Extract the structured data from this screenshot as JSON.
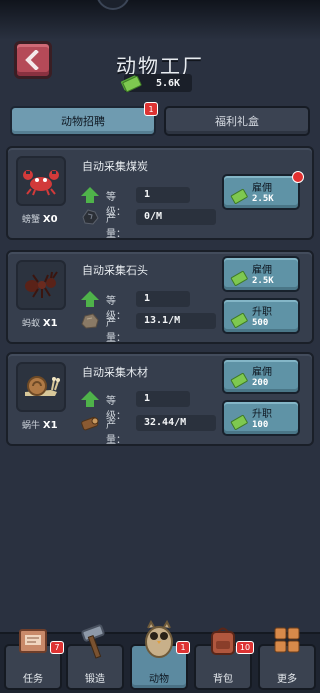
{
  "header": {
    "title": "动物工厂",
    "currency_value": "5.6K"
  },
  "tabs": [
    {
      "label": "动物招聘",
      "badge": "1",
      "active": true
    },
    {
      "label": "福利礼盒",
      "active": false
    }
  ],
  "animals": [
    {
      "name": "螃蟹",
      "count": "X0",
      "task": "自动采集煤炭",
      "level_label": "等级：",
      "level": "1",
      "output_label": "产量：",
      "output": "0/M",
      "resource_icon": "coal-icon",
      "hire_label": "雇佣",
      "hire_cost": "2.5K",
      "hire_notification": true
    },
    {
      "name": "蚂蚁",
      "count": "X1",
      "task": "自动采集石头",
      "level_label": "等级：",
      "level": "1",
      "output_label": "产量：",
      "output": "13.1/M",
      "resource_icon": "stone-icon",
      "hire_label": "雇佣",
      "hire_cost": "2.5K",
      "upgrade_label": "升职",
      "upgrade_cost": "500"
    },
    {
      "name": "蜗牛",
      "count": "X1",
      "task": "自动采集木材",
      "level_label": "等级：",
      "level": "1",
      "output_label": "产量：",
      "output": "32.44/M",
      "resource_icon": "wood-icon",
      "hire_label": "雇佣",
      "hire_cost": "200",
      "upgrade_label": "升职",
      "upgrade_cost": "100"
    }
  ],
  "nav": [
    {
      "label": "任务",
      "badge": "7"
    },
    {
      "label": "锻造"
    },
    {
      "label": "动物",
      "badge": "1",
      "active": true
    },
    {
      "label": "背包",
      "badge": "10"
    },
    {
      "label": "更多"
    }
  ],
  "colors": {
    "accent": "#5f93a6",
    "background": "#2a3140",
    "card": "#363e4d",
    "badge": "#dd3333",
    "cash": "#7ec850"
  }
}
